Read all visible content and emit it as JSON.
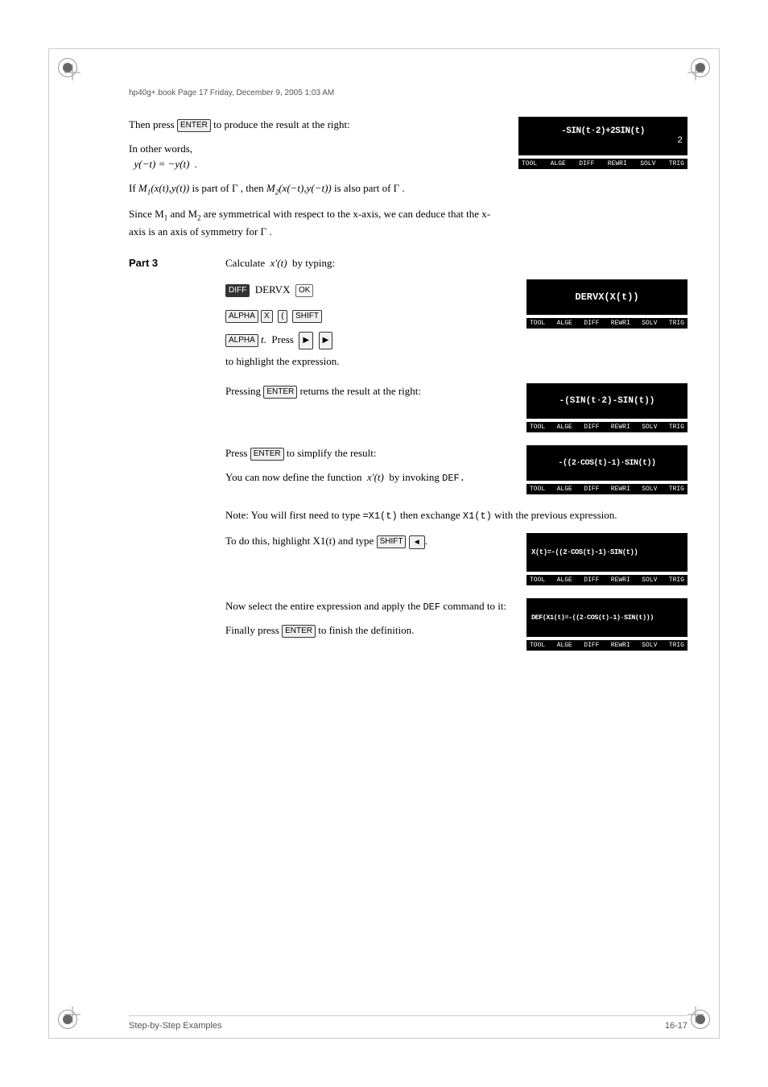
{
  "page": {
    "header_file": "hp40g+.book  Page 17  Friday, December 9, 2005  1:03 AM",
    "footer_left": "Step-by-Step Examples",
    "footer_right": "16-17"
  },
  "content": {
    "section_intro": {
      "then_press_text": "Then press",
      "enter_key": "ENTER",
      "produce_text": "to produce the result at the right:",
      "other_words_text": "In other words,",
      "formula_text": "y(−t) = −y(t)  .",
      "symmetry_text1": "If M",
      "symmetry_text2": "is part of Γ , then M",
      "symmetry_text3": "is also part of Γ .",
      "since_text": "Since M",
      "and_text": "and M",
      "axis_text": "are symmetrical with respect to the x-axis, we can deduce that the x-axis is an axis of symmetry for Γ ."
    },
    "part3": {
      "label": "Part 3",
      "calculate_text": "Calculate  x′(t)  by typing:",
      "key_sequence_line1": "DIFF  DERVX  OK",
      "key_alpha": "ALPHA",
      "key_x": "X",
      "key_paren": "(",
      "key_shift": "SHIFT",
      "key_alpha2": "ALPHA",
      "key_t": "t",
      "press_text": "Press",
      "arrow_right1": "▶",
      "arrow_right2": "▶",
      "highlight_text": "to highlight the expression.",
      "pressing_enter_text": "Pressing",
      "returns_text": "returns the result at the right:",
      "press_enter_simplify": "Press",
      "to_simplify": "to simplify the result:",
      "define_text": "You can now define the function  x′(t)  by invoking",
      "def_text": "DEF.",
      "note_text": "Note: You will first need to type =X1(t) then exchange X1(t) with the previous expression.",
      "highlight_x1t": "To do this, highlight X1(t) and type",
      "shift_key": "SHIFT",
      "left_arrow": "◄",
      "select_text": "Now select the entire expression and apply the",
      "def_cmd": "DEF",
      "command_text": "command to it:",
      "finally_text": "Finally press",
      "finish_text": "to finish the definition."
    },
    "screens": {
      "screen1": {
        "line1": "-SIN(t·2)+2SIN(t)",
        "line2": "2",
        "toolbar": [
          "TOOL",
          "ALGE",
          "DIFF",
          "REWRI",
          "SOLV",
          "TRIG"
        ]
      },
      "screen2": {
        "line1": "DERVX(X(t))",
        "toolbar": [
          "TOOL",
          "ALGE",
          "DIFF",
          "REWRI",
          "SOLV",
          "TRIG"
        ]
      },
      "screen3": {
        "line1": "-(SIN(t·2)-SIN(t))",
        "toolbar": [
          "TOOL",
          "ALGE",
          "DIFF",
          "REWRI",
          "SOLV",
          "TRIG"
        ]
      },
      "screen4": {
        "line1": "-((2·COS(t)-1)·SIN(t))",
        "toolbar": [
          "TOOL",
          "ALGE",
          "DIFF",
          "REWRI",
          "SOLV",
          "TRIG"
        ]
      },
      "screen5": {
        "line1": "X(t)=-((2·COS(t)-1)·SIN(t))",
        "toolbar": [
          "TOOL",
          "ALGE",
          "DIFF",
          "REWRI",
          "SOLV",
          "TRIG"
        ]
      },
      "screen6": {
        "line1": "DEF(X1(t)=-((2·COS(t)-1)·SIN(t)))",
        "toolbar": [
          "TOOL",
          "ALGE",
          "DIFF",
          "REWRI",
          "SOLV",
          "TRIG"
        ]
      }
    }
  }
}
